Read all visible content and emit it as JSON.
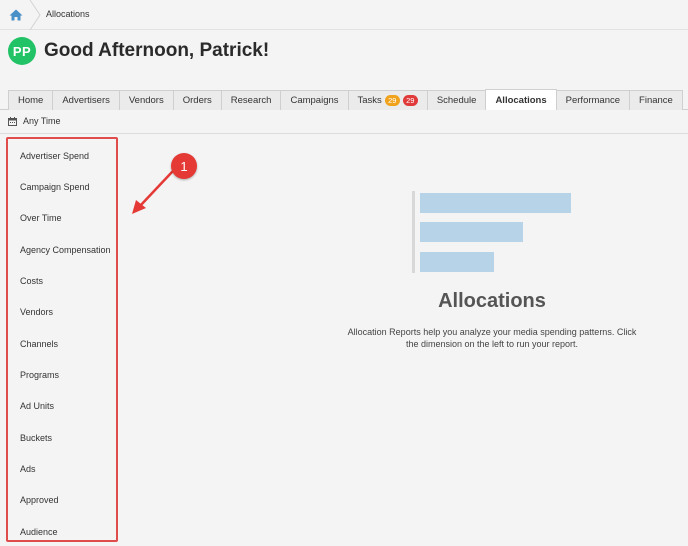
{
  "breadcrumb": {
    "current": "Allocations"
  },
  "user": {
    "initials": "PP",
    "greeting": "Good Afternoon, Patrick!"
  },
  "tabs": [
    {
      "label": "Home"
    },
    {
      "label": "Advertisers"
    },
    {
      "label": "Vendors"
    },
    {
      "label": "Orders"
    },
    {
      "label": "Research"
    },
    {
      "label": "Campaigns"
    },
    {
      "label": "Tasks",
      "badges": [
        "29",
        "29"
      ]
    },
    {
      "label": "Schedule"
    },
    {
      "label": "Allocations",
      "active": true
    },
    {
      "label": "Performance"
    },
    {
      "label": "Finance"
    }
  ],
  "filter": {
    "label": "Any Time"
  },
  "sidebar": {
    "items": [
      "Advertiser Spend",
      "Campaign Spend",
      "Over Time",
      "Agency Compensation",
      "Costs",
      "Vendors",
      "Channels",
      "Programs",
      "Ad Units",
      "Buckets",
      "Ads",
      "Approved",
      "Audience"
    ]
  },
  "callout": {
    "number": "1"
  },
  "empty_state": {
    "title": "Allocations",
    "description": "Allocation Reports help you analyze your media spending patterns. Click the dimension on the left to run your report."
  },
  "colors": {
    "accent_green": "#22c266",
    "badge_orange": "#f0a21c",
    "badge_red": "#e03a3a",
    "highlight_red": "#e04b4b",
    "illustration_bar": "#b6d3e8"
  }
}
